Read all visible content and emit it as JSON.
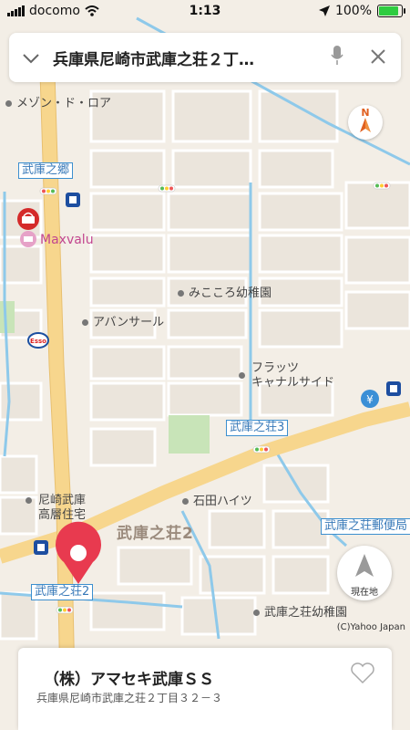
{
  "status_bar": {
    "carrier": "docomo",
    "time": "1:13",
    "battery": "100%",
    "battery_level": 1.0
  },
  "search": {
    "query": "兵庫県尼崎市武庫之荘２丁…"
  },
  "map": {
    "station_labels": [
      "武庫之郷",
      "武庫之荘3",
      "武庫之荘2",
      "武庫之荘郵便局"
    ],
    "poi_labels": [
      "メゾン・ド・ロア",
      "みこころ幼稚園",
      "アバンサール",
      "フラッツ",
      "キャナルサイド",
      "石田ハイツ",
      "尼崎武庫",
      "高層住宅",
      "武庫之荘幼稚園"
    ],
    "store_label": "Maxvalu",
    "area_label": "武庫之荘2",
    "compass_label": "N",
    "current_location_label": "現在地",
    "copyright": "(C)Yahoo Japan"
  },
  "place_card": {
    "name": "（株）アマセキ武庫ＳＳ",
    "address": "兵庫県尼崎市武庫之荘２丁目３２－３"
  },
  "colors": {
    "main_road": "#f7d68d",
    "water": "#8ec9ea",
    "park": "#c8e4b8",
    "pin": "#e83a4f",
    "brand_maxvalu": "#c2468f"
  }
}
